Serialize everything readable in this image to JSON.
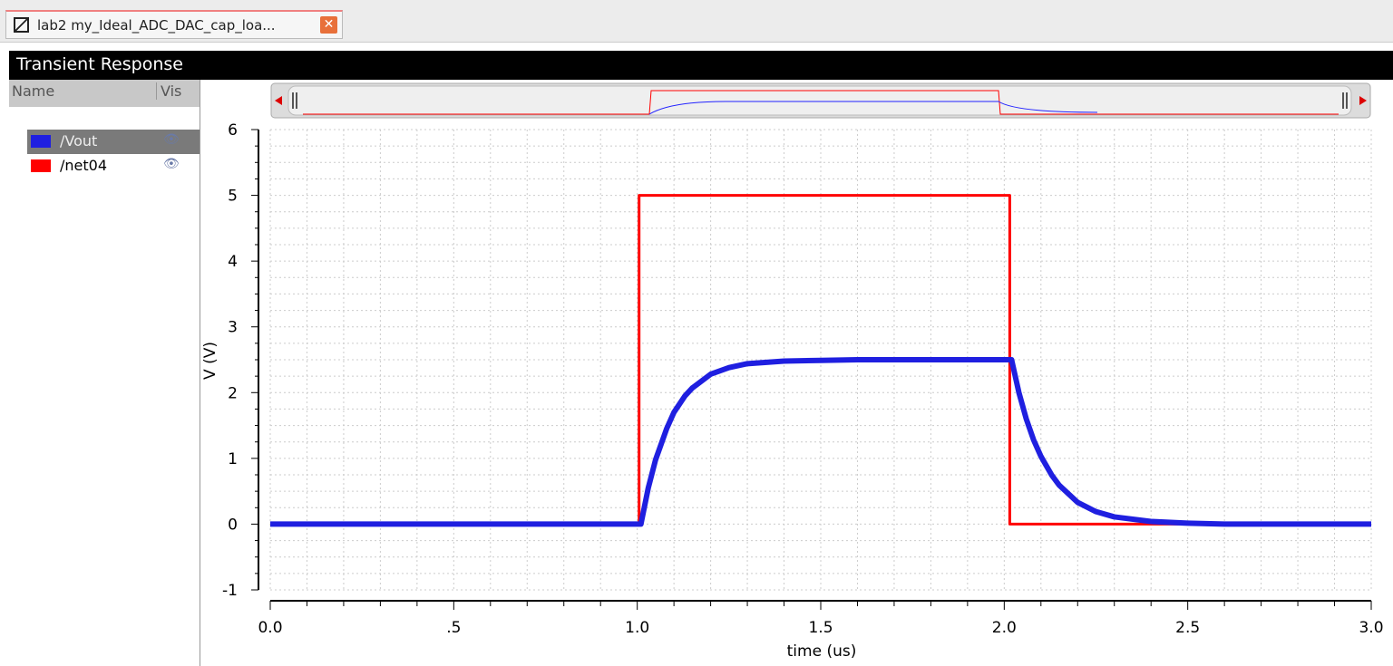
{
  "tab": {
    "label": "lab2 my_Ideal_ADC_DAC_cap_loa...",
    "close": "✕"
  },
  "window_title": "Transient Response",
  "legend_panel": {
    "col_name": "Name",
    "col_vis": "Vis",
    "items": [
      {
        "name": "/Vout",
        "color": "#1f1fe0",
        "visible_icon": "eye-icon",
        "selected": true
      },
      {
        "name": "/net04",
        "color": "#ff0000",
        "visible_icon": "eye-icon",
        "selected": false
      }
    ]
  },
  "chart_data": {
    "type": "line",
    "title": "Transient Response",
    "xlabel": "time (us)",
    "ylabel": "V (V)",
    "xlim": [
      0,
      3
    ],
    "ylim": [
      -1,
      6
    ],
    "xticks": [
      0,
      0.5,
      1,
      1.5,
      2,
      2.5,
      3
    ],
    "xtick_labels": [
      "0.0",
      ".5",
      "1.0",
      "1.5",
      "2.0",
      "2.5",
      "3.0"
    ],
    "yticks": [
      6,
      5,
      4,
      3,
      2,
      1,
      0,
      -1
    ],
    "ytick_labels": [
      "6",
      "5",
      "4",
      "3",
      "2",
      "1",
      "0",
      "-1"
    ],
    "grid": true,
    "series": [
      {
        "name": "/net04",
        "color": "#ff0000",
        "x": [
          0,
          1.0,
          1.005,
          1.005,
          2.01,
          2.015,
          2.015,
          3.0
        ],
        "y": [
          0,
          0,
          0,
          5,
          5,
          5,
          0,
          0
        ]
      },
      {
        "name": "/Vout",
        "color": "#1f1fe0",
        "x": [
          0,
          1.01,
          1.03,
          1.05,
          1.08,
          1.1,
          1.13,
          1.15,
          1.2,
          1.25,
          1.3,
          1.4,
          1.5,
          1.6,
          2.02,
          2.04,
          2.06,
          2.08,
          2.1,
          2.13,
          2.15,
          2.2,
          2.25,
          2.3,
          2.4,
          2.5,
          2.6,
          3.0
        ],
        "y": [
          0,
          0,
          0.55,
          0.98,
          1.45,
          1.7,
          1.95,
          2.07,
          2.28,
          2.38,
          2.44,
          2.48,
          2.49,
          2.5,
          2.5,
          2.0,
          1.6,
          1.28,
          1.03,
          0.74,
          0.59,
          0.33,
          0.19,
          0.11,
          0.04,
          0.015,
          0,
          0
        ]
      }
    ]
  }
}
